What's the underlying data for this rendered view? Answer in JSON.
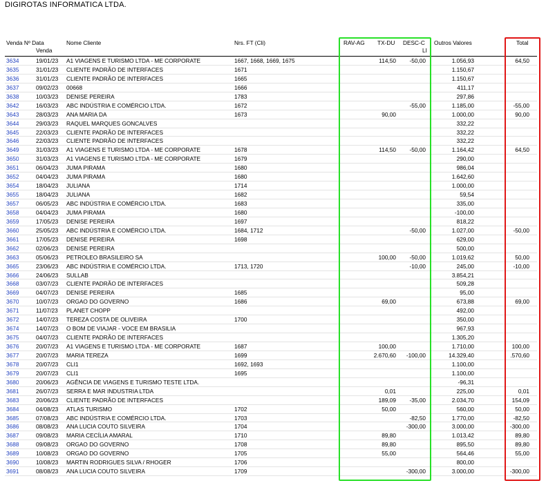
{
  "company": "DIGIROTAS INFORMATICA LTDA.",
  "headers": {
    "venda": "Venda Nº Data",
    "venda2": "Venda",
    "cliente": "Nome Cliente",
    "ft": "Nrs. FT (Cli)",
    "rav": "RAV-AG",
    "txdu": "TX-DU",
    "desc": "DESC-C",
    "desc2": "LI",
    "outros": "Outros Valores",
    "total": "Total"
  },
  "rows": [
    {
      "venda": "3634",
      "data": "19/01/23",
      "cliente": "A1 VIAGENS E TURISMO LTDA - ME CORPORATE",
      "ft": "1667, 1668, 1669, 1675",
      "rav": "",
      "txdu": "114,50",
      "desc": "-50,00",
      "outros": "1.056,93",
      "total": "64,50"
    },
    {
      "venda": "3635",
      "data": "31/01/23",
      "cliente": "CLIENTE PADRÃO DE INTERFACES",
      "ft": "1671",
      "rav": "",
      "txdu": "",
      "desc": "",
      "outros": "1.150,67",
      "total": ""
    },
    {
      "venda": "3636",
      "data": "31/01/23",
      "cliente": "CLIENTE PADRÃO DE INTERFACES",
      "ft": "1665",
      "rav": "",
      "txdu": "",
      "desc": "",
      "outros": "1.150,67",
      "total": ""
    },
    {
      "venda": "3637",
      "data": "09/02/23",
      "cliente": "00668",
      "ft": "1666",
      "rav": "",
      "txdu": "",
      "desc": "",
      "outros": "411,17",
      "total": ""
    },
    {
      "venda": "3638",
      "data": "10/03/23",
      "cliente": "DENISE PEREIRA",
      "ft": "1783",
      "rav": "",
      "txdu": "",
      "desc": "",
      "outros": "297,86",
      "total": ""
    },
    {
      "venda": "3642",
      "data": "16/03/23",
      "cliente": "ABC INDÚSTRIA E COMÉRCIO LTDA.",
      "ft": "1672",
      "rav": "",
      "txdu": "",
      "desc": "-55,00",
      "outros": "1.185,00",
      "total": "-55,00"
    },
    {
      "venda": "3643",
      "data": "28/03/23",
      "cliente": "ANA MARIA DA",
      "ft": "1673",
      "rav": "",
      "txdu": "90,00",
      "desc": "",
      "outros": "1.000,00",
      "total": "90,00"
    },
    {
      "venda": "3644",
      "data": "29/03/23",
      "cliente": "RAQUEL MARQUES GONCALVES",
      "ft": "",
      "rav": "",
      "txdu": "",
      "desc": "",
      "outros": "332,22",
      "total": ""
    },
    {
      "venda": "3645",
      "data": "22/03/23",
      "cliente": "CLIENTE PADRÃO DE INTERFACES",
      "ft": "",
      "rav": "",
      "txdu": "",
      "desc": "",
      "outros": "332,22",
      "total": ""
    },
    {
      "venda": "3646",
      "data": "22/03/23",
      "cliente": "CLIENTE PADRÃO DE INTERFACES",
      "ft": "",
      "rav": "",
      "txdu": "",
      "desc": "",
      "outros": "332,22",
      "total": ""
    },
    {
      "venda": "3649",
      "data": "31/03/23",
      "cliente": "A1 VIAGENS E TURISMO LTDA - ME CORPORATE",
      "ft": "1678",
      "rav": "",
      "txdu": "114,50",
      "desc": "-50,00",
      "outros": "1.164,42",
      "total": "64,50"
    },
    {
      "venda": "3650",
      "data": "31/03/23",
      "cliente": "A1 VIAGENS E TURISMO LTDA - ME CORPORATE",
      "ft": "1679",
      "rav": "",
      "txdu": "",
      "desc": "",
      "outros": "290,00",
      "total": ""
    },
    {
      "venda": "3651",
      "data": "06/04/23",
      "cliente": "JUMA PIRAMA",
      "ft": "1680",
      "rav": "",
      "txdu": "",
      "desc": "",
      "outros": "986,04",
      "total": ""
    },
    {
      "venda": "3652",
      "data": "04/04/23",
      "cliente": "JUMA PIRAMA",
      "ft": "1680",
      "rav": "",
      "txdu": "",
      "desc": "",
      "outros": "1.642,60",
      "total": ""
    },
    {
      "venda": "3654",
      "data": "18/04/23",
      "cliente": "JULIANA",
      "ft": "1714",
      "rav": "",
      "txdu": "",
      "desc": "",
      "outros": "1.000,00",
      "total": ""
    },
    {
      "venda": "3655",
      "data": "18/04/23",
      "cliente": "JULIANA",
      "ft": "1682",
      "rav": "",
      "txdu": "",
      "desc": "",
      "outros": "59,54",
      "total": ""
    },
    {
      "venda": "3657",
      "data": "06/05/23",
      "cliente": "ABC INDÚSTRIA E COMÉRCIO LTDA.",
      "ft": "1683",
      "rav": "",
      "txdu": "",
      "desc": "",
      "outros": "335,00",
      "total": ""
    },
    {
      "venda": "3658",
      "data": "04/04/23",
      "cliente": "JUMA PIRAMA",
      "ft": "1680",
      "rav": "",
      "txdu": "",
      "desc": "",
      "outros": "-100,00",
      "total": ""
    },
    {
      "venda": "3659",
      "data": "17/05/23",
      "cliente": "DENISE PEREIRA",
      "ft": "1697",
      "rav": "",
      "txdu": "",
      "desc": "",
      "outros": "818,22",
      "total": ""
    },
    {
      "venda": "3660",
      "data": "25/05/23",
      "cliente": "ABC INDÚSTRIA E COMÉRCIO LTDA.",
      "ft": "1684, 1712",
      "rav": "",
      "txdu": "",
      "desc": "-50,00",
      "outros": "1.027,00",
      "total": "-50,00"
    },
    {
      "venda": "3661",
      "data": "17/05/23",
      "cliente": "DENISE PEREIRA",
      "ft": "1698",
      "rav": "",
      "txdu": "",
      "desc": "",
      "outros": "629,00",
      "total": ""
    },
    {
      "venda": "3662",
      "data": "02/06/23",
      "cliente": "DENISE PEREIRA",
      "ft": "",
      "rav": "",
      "txdu": "",
      "desc": "",
      "outros": "500,00",
      "total": ""
    },
    {
      "venda": "3663",
      "data": "05/06/23",
      "cliente": "PETROLEO BRASILEIRO SA",
      "ft": "",
      "rav": "",
      "txdu": "100,00",
      "desc": "-50,00",
      "outros": "1.019,62",
      "total": "50,00"
    },
    {
      "venda": "3665",
      "data": "23/06/23",
      "cliente": "ABC INDÚSTRIA E COMÉRCIO LTDA.",
      "ft": "1713, 1720",
      "rav": "",
      "txdu": "",
      "desc": "-10,00",
      "outros": "245,00",
      "total": "-10,00"
    },
    {
      "venda": "3666",
      "data": "24/06/23",
      "cliente": "SULLAB",
      "ft": "",
      "rav": "",
      "txdu": "",
      "desc": "",
      "outros": "3.854,21",
      "total": ""
    },
    {
      "venda": "3668",
      "data": "03/07/23",
      "cliente": "CLIENTE PADRÃO DE INTERFACES",
      "ft": "",
      "rav": "",
      "txdu": "",
      "desc": "",
      "outros": "509,28",
      "total": ""
    },
    {
      "venda": "3669",
      "data": "04/07/23",
      "cliente": "DENISE PEREIRA",
      "ft": "1685",
      "rav": "",
      "txdu": "",
      "desc": "",
      "outros": "95,00",
      "total": ""
    },
    {
      "venda": "3670",
      "data": "10/07/23",
      "cliente": "ORGAO DO GOVERNO",
      "ft": "1686",
      "rav": "",
      "txdu": "69,00",
      "desc": "",
      "outros": "673,88",
      "total": "69,00"
    },
    {
      "venda": "3671",
      "data": "11/07/23",
      "cliente": "PLANET CHOPP",
      "ft": "",
      "rav": "",
      "txdu": "",
      "desc": "",
      "outros": "492,00",
      "total": ""
    },
    {
      "venda": "3672",
      "data": "14/07/23",
      "cliente": "TEREZA COSTA DE OLIVEIRA",
      "ft": "1700",
      "rav": "",
      "txdu": "",
      "desc": "",
      "outros": "350,00",
      "total": ""
    },
    {
      "venda": "3674",
      "data": "14/07/23",
      "cliente": "O BOM DE VIAJAR - VOCE EM BRASILIA",
      "ft": "",
      "rav": "",
      "txdu": "",
      "desc": "",
      "outros": "967,93",
      "total": ""
    },
    {
      "venda": "3675",
      "data": "04/07/23",
      "cliente": "CLIENTE PADRÃO DE INTERFACES",
      "ft": "",
      "rav": "",
      "txdu": "",
      "desc": "",
      "outros": "1.305,20",
      "total": ""
    },
    {
      "venda": "3676",
      "data": "20/07/23",
      "cliente": "A1 VIAGENS E TURISMO LTDA - ME CORPORATE",
      "ft": "1687",
      "rav": "",
      "txdu": "100,00",
      "desc": "",
      "outros": "1.710,00",
      "total": "100,00"
    },
    {
      "venda": "3677",
      "data": "20/07/23",
      "cliente": "MARIA TEREZA",
      "ft": "1699",
      "rav": "",
      "txdu": "2.670,60",
      "desc": "-100,00",
      "outros": "14.329,40",
      "total": ".570,60"
    },
    {
      "venda": "3678",
      "data": "20/07/23",
      "cliente": "CLI1",
      "ft": "1692, 1693",
      "rav": "",
      "txdu": "",
      "desc": "",
      "outros": "1.100,00",
      "total": ""
    },
    {
      "venda": "3679",
      "data": "20/07/23",
      "cliente": "CLI1",
      "ft": "1695",
      "rav": "",
      "txdu": "",
      "desc": "",
      "outros": "1.100,00",
      "total": ""
    },
    {
      "venda": "3680",
      "data": "20/06/23",
      "cliente": "AGÊNCIA DE VIAGENS E TURISMO TESTE LTDA.",
      "ft": "",
      "rav": "",
      "txdu": "",
      "desc": "",
      "outros": "-96,31",
      "total": ""
    },
    {
      "venda": "3681",
      "data": "26/07/23",
      "cliente": "SERRA E MAR INDUSTRIA LTDA",
      "ft": "",
      "rav": "",
      "txdu": "0,01",
      "desc": "",
      "outros": "225,00",
      "total": "0,01"
    },
    {
      "venda": "3683",
      "data": "20/06/23",
      "cliente": "CLIENTE PADRÃO DE INTERFACES",
      "ft": "",
      "rav": "",
      "txdu": "189,09",
      "desc": "-35,00",
      "outros": "2.034,70",
      "total": "154,09"
    },
    {
      "venda": "3684",
      "data": "04/08/23",
      "cliente": "ATLAS TURISMO",
      "ft": "1702",
      "rav": "",
      "txdu": "50,00",
      "desc": "",
      "outros": "560,00",
      "total": "50,00"
    },
    {
      "venda": "3685",
      "data": "07/08/23",
      "cliente": "ABC INDÚSTRIA E COMÉRCIO LTDA.",
      "ft": "1703",
      "rav": "",
      "txdu": "",
      "desc": "-82,50",
      "outros": "1.770,00",
      "total": "-82,50"
    },
    {
      "venda": "3686",
      "data": "08/08/23",
      "cliente": "ANA LUCIA COUTO SILVEIRA",
      "ft": "1704",
      "rav": "",
      "txdu": "",
      "desc": "-300,00",
      "outros": "3.000,00",
      "total": "-300,00"
    },
    {
      "venda": "3687",
      "data": "09/08/23",
      "cliente": "MARIA CECÍLIA AMARAL",
      "ft": "1710",
      "rav": "",
      "txdu": "89,80",
      "desc": "",
      "outros": "1.013,42",
      "total": "89,80"
    },
    {
      "venda": "3688",
      "data": "09/08/23",
      "cliente": "ORGAO DO GOVERNO",
      "ft": "1708",
      "rav": "",
      "txdu": "89,80",
      "desc": "",
      "outros": "895,50",
      "total": "89,80"
    },
    {
      "venda": "3689",
      "data": "10/08/23",
      "cliente": "ORGAO DO GOVERNO",
      "ft": "1705",
      "rav": "",
      "txdu": "55,00",
      "desc": "",
      "outros": "564,46",
      "total": "55,00"
    },
    {
      "venda": "3690",
      "data": "10/08/23",
      "cliente": "MARTIN RODRIGUES SILVA / RHOGER",
      "ft": "1706",
      "rav": "",
      "txdu": "",
      "desc": "",
      "outros": "800,00",
      "total": ""
    },
    {
      "venda": "3691",
      "data": "08/08/23",
      "cliente": "ANA LUCIA COUTO SILVEIRA",
      "ft": "1709",
      "rav": "",
      "txdu": "",
      "desc": "-300,00",
      "outros": "3.000,00",
      "total": "-300,00"
    }
  ],
  "highlight_colors": {
    "green_box": "#27e027",
    "red_box": "#e01515",
    "venda_link": "#1f3fbf"
  }
}
